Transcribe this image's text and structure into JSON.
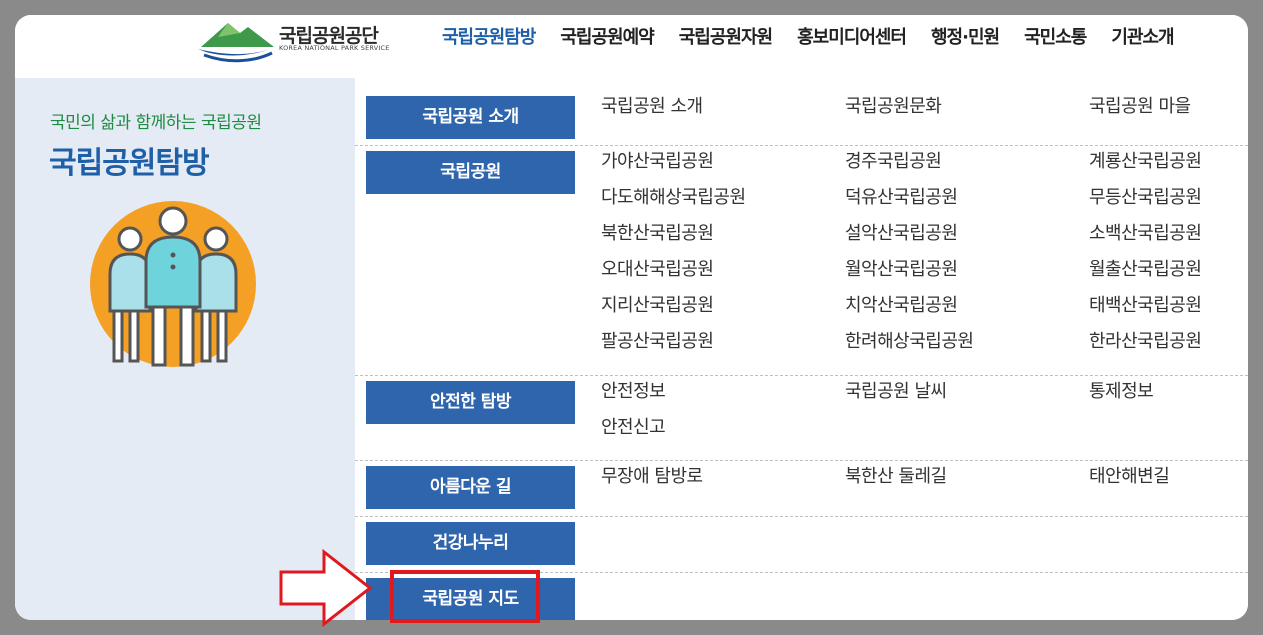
{
  "header": {
    "logo_title": "국립공원공단",
    "logo_subtitle": "KOREA NATIONAL PARK SERVICE",
    "nav": [
      {
        "label": "국립공원탐방",
        "active": true
      },
      {
        "label": "국립공원예약",
        "active": false
      },
      {
        "label": "국립공원자원",
        "active": false
      },
      {
        "label": "홍보미디어센터",
        "active": false
      },
      {
        "label": "행정·민원",
        "active": false
      },
      {
        "label": "국민소통",
        "active": false
      },
      {
        "label": "기관소개",
        "active": false
      }
    ]
  },
  "sidebar": {
    "subtitle": "국민의 삶과 함께하는 국립공원",
    "title": "국립공원탐방"
  },
  "menu": {
    "sections": [
      {
        "label": "국립공원 소개",
        "links": [
          "국립공원 소개",
          "국립공원문화",
          "국립공원 마을"
        ]
      },
      {
        "label": "국립공원",
        "links": [
          "가야산국립공원",
          "경주국립공원",
          "계룡산국립공원",
          "다도해해상국립공원",
          "덕유산국립공원",
          "무등산국립공원",
          "북한산국립공원",
          "설악산국립공원",
          "소백산국립공원",
          "오대산국립공원",
          "월악산국립공원",
          "월출산국립공원",
          "지리산국립공원",
          "치악산국립공원",
          "태백산국립공원",
          "팔공산국립공원",
          "한려해상국립공원",
          "한라산국립공원"
        ]
      },
      {
        "label": "안전한 탐방",
        "links": [
          "안전정보",
          "국립공원 날씨",
          "통제정보",
          "안전신고"
        ]
      },
      {
        "label": "아름다운 길",
        "links": [
          "무장애 탐방로",
          "북한산 둘레길",
          "태안해변길"
        ]
      },
      {
        "label": "건강나누리",
        "links": []
      },
      {
        "label": "국립공원 지도",
        "links": []
      }
    ]
  },
  "colors": {
    "accent_blue": "#1e5fa8",
    "button_blue": "#2f65ad",
    "sidebar_bg": "#e5ebf4",
    "subtitle_green": "#1f8a44",
    "highlight_red": "#e0191f"
  }
}
